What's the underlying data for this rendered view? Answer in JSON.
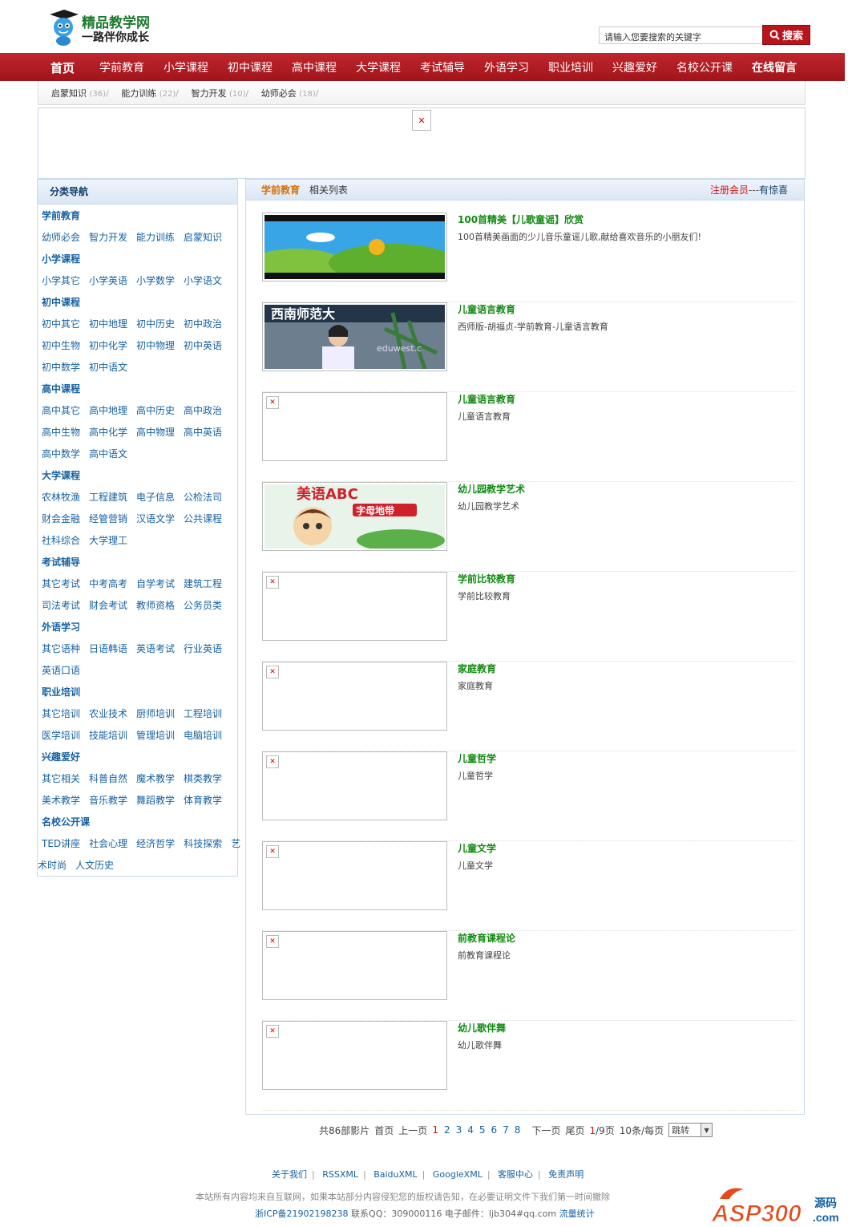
{
  "header": {
    "logo_title": "精品教学网",
    "logo_slogan": "一路伴你成长",
    "search_placeholder": "请输入您要搜索的关键字",
    "search_button": "搜索"
  },
  "nav": {
    "items": [
      "首页",
      "学前教育",
      "小学课程",
      "初中课程",
      "高中课程",
      "大学课程",
      "考试辅导",
      "外语学习",
      "职业培训",
      "兴趣爱好",
      "名校公开课",
      "在线留言"
    ]
  },
  "subnav": {
    "items": [
      {
        "label": "启蒙知识",
        "count": "(36)"
      },
      {
        "label": "能力训练",
        "count": "(22)"
      },
      {
        "label": "智力开发",
        "count": "(10)"
      },
      {
        "label": "幼师必会",
        "count": "(18)"
      }
    ]
  },
  "sidebar": {
    "title": "分类导航",
    "groups": [
      {
        "cat": "学前教育",
        "rows": [
          [
            "幼师必会",
            "智力开发",
            "能力训练",
            "启蒙知识"
          ]
        ]
      },
      {
        "cat": "小学课程",
        "rows": [
          [
            "小学其它",
            "小学英语",
            "小学数学",
            "小学语文"
          ]
        ]
      },
      {
        "cat": "初中课程",
        "rows": [
          [
            "初中其它",
            "初中地理",
            "初中历史",
            "初中政治"
          ],
          [
            "初中生物",
            "初中化学",
            "初中物理",
            "初中英语"
          ],
          [
            "初中数学",
            "初中语文"
          ]
        ]
      },
      {
        "cat": "高中课程",
        "rows": [
          [
            "高中其它",
            "高中地理",
            "高中历史",
            "高中政治"
          ],
          [
            "高中生物",
            "高中化学",
            "高中物理",
            "高中英语"
          ],
          [
            "高中数学",
            "高中语文"
          ]
        ]
      },
      {
        "cat": "大学课程",
        "rows": [
          [
            "农林牧渔",
            "工程建筑",
            "电子信息",
            "公检法司"
          ],
          [
            "财会金融",
            "经管营销",
            "汉语文学",
            "公共课程"
          ],
          [
            "社科综合",
            "大学理工"
          ]
        ]
      },
      {
        "cat": "考试辅导",
        "rows": [
          [
            "其它考试",
            "中考高考",
            "自学考试",
            "建筑工程"
          ],
          [
            "司法考试",
            "财会考试",
            "教师资格",
            "公务员类"
          ]
        ]
      },
      {
        "cat": "外语学习",
        "rows": [
          [
            "其它语种",
            "日语韩语",
            "英语考试",
            "行业英语"
          ],
          [
            "英语口语"
          ]
        ]
      },
      {
        "cat": "职业培训",
        "rows": [
          [
            "其它培训",
            "农业技术",
            "厨师培训",
            "工程培训"
          ],
          [
            "医学培训",
            "技能培训",
            "管理培训",
            "电脑培训"
          ]
        ]
      },
      {
        "cat": "兴趣爱好",
        "rows": [
          [
            "其它相关",
            "科普自然",
            "魔术教学",
            "棋类教学"
          ],
          [
            "美术教学",
            "音乐教学",
            "舞蹈教学",
            "体育教学"
          ]
        ]
      },
      {
        "cat": "名校公开课",
        "rows": [
          [
            "TED讲座",
            "社会心理",
            "经济哲学",
            "科技探索",
            "艺"
          ],
          [
            "术时尚",
            "人文历史"
          ]
        ]
      }
    ]
  },
  "main": {
    "current": "学前教育",
    "related": "相关列表",
    "register": "注册会员",
    "dashes": "---",
    "surprise": "有惊喜",
    "items": [
      {
        "title": "100首精美【儿歌童谣】欣赏",
        "desc": "100首精美画面的少儿音乐童谣儿歌,献给喜欢音乐的小朋友们!",
        "thumb": "cartoon-landscape"
      },
      {
        "title": "儿童语言教育",
        "desc": "西师版-胡福贞-学前教育-儿童语言教育",
        "thumb": "lecture"
      },
      {
        "title": "儿童语言教育",
        "desc": "儿童语言教育",
        "thumb": "broken"
      },
      {
        "title": "幼儿园教学艺术",
        "desc": "幼儿园教学艺术",
        "thumb": "abc"
      },
      {
        "title": "学前比较教育",
        "desc": "学前比较教育",
        "thumb": "broken"
      },
      {
        "title": "家庭教育",
        "desc": "家庭教育",
        "thumb": "broken"
      },
      {
        "title": "儿童哲学",
        "desc": "儿童哲学",
        "thumb": "broken"
      },
      {
        "title": "儿童文学",
        "desc": "儿童文学",
        "thumb": "broken"
      },
      {
        "title": "前教育课程论",
        "desc": "前教育课程论",
        "thumb": "broken"
      },
      {
        "title": "幼儿歌伴舞",
        "desc": "幼儿歌伴舞",
        "thumb": "broken"
      }
    ],
    "thumb_text": {
      "abc": "美语ABC",
      "abc_sub": "字母地带",
      "lecture": "西南师范大",
      "site": "eduwest.c"
    }
  },
  "pager": {
    "total": "共86部影片",
    "first": "首页",
    "prev": "上一页",
    "pages": [
      "1",
      "2",
      "3",
      "4",
      "5",
      "6",
      "7",
      "8"
    ],
    "current_page": "1",
    "next": "下一页",
    "last": "尾页",
    "page_of_cur": "1",
    "page_of_rest": "/9页",
    "per_page": "10条/每页",
    "jump": "跳转"
  },
  "footer": {
    "links": [
      "关于我们",
      "RSSXML",
      "BaiduXML",
      "GoogleXML",
      "客服中心",
      "免责声明"
    ],
    "note": "本站所有内容均来自互联网，如果本站部分内容侵犯您的版权请告知，在必要证明文件下我们第一时间撤除",
    "icp": "浙ICP备21902198238",
    "qq": "联系QQ：309000116",
    "email": "电子邮件：ljb304#qq.com",
    "stats": "流量统计"
  },
  "watermark": {
    "brand": "ASP300",
    "sub": "源码",
    "domain": ".com"
  },
  "colors": {
    "nav_red": "#b8141c",
    "link_blue": "#1561a3",
    "title_green": "#128a12",
    "accent_orange": "#d1720f"
  }
}
